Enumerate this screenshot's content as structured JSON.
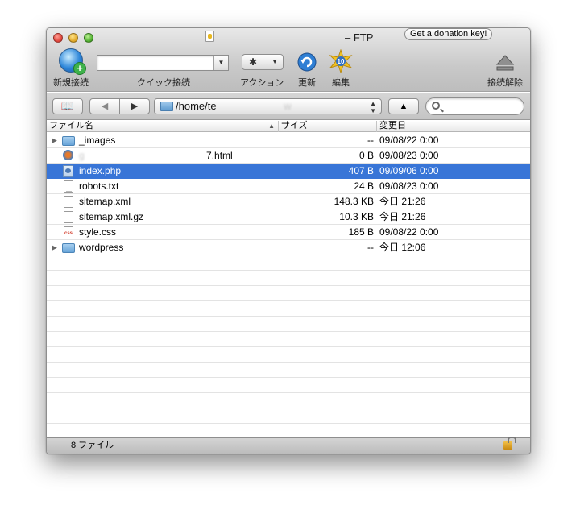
{
  "window": {
    "title": "– FTP",
    "donation_label": "Get a donation key!"
  },
  "toolbar": {
    "new_connection_label": "新規接続",
    "quick_connect_label": "クイック接続",
    "quick_connect_value": "",
    "action_label": "アクション",
    "refresh_label": "更新",
    "edit_label": "編集",
    "disconnect_label": "接続解除"
  },
  "navbar": {
    "path": "/home/te",
    "path_obscured": "w",
    "search_value": ""
  },
  "columns": {
    "name": "ファイル名",
    "size": "サイズ",
    "date": "変更日"
  },
  "files": [
    {
      "name": "_images",
      "size": "--",
      "date": "09/08/22 0:00",
      "type": "folder",
      "icon": "folder-icon"
    },
    {
      "name_obscured": "g",
      "name": "7.html",
      "size": "0 B",
      "date": "09/08/23 0:00",
      "type": "html",
      "icon": "html-file-icon"
    },
    {
      "name": "index.php",
      "size": "407 B",
      "date": "09/09/06 0:00",
      "type": "php",
      "icon": "php-file-icon",
      "selected": true
    },
    {
      "name": "robots.txt",
      "size": "24 B",
      "date": "09/08/23 0:00",
      "type": "txt",
      "icon": "text-file-icon"
    },
    {
      "name": "sitemap.xml",
      "size": "148.3 KB",
      "date": "今日 21:26",
      "type": "xml",
      "icon": "file-icon"
    },
    {
      "name": "sitemap.xml.gz",
      "size": "10.3 KB",
      "date": "今日 21:26",
      "type": "gz",
      "icon": "archive-file-icon"
    },
    {
      "name": "style.css",
      "size": "185 B",
      "date": "09/08/22 0:00",
      "type": "css",
      "icon": "css-file-icon"
    },
    {
      "name": "wordpress",
      "size": "--",
      "date": "今日 12:06",
      "type": "folder",
      "icon": "folder-icon"
    }
  ],
  "status": {
    "file_count": "8 ファイル"
  },
  "colors": {
    "selection": "#3875d7",
    "toolbar_top": "#e8e8e8",
    "toolbar_bottom": "#bdbdbd"
  }
}
